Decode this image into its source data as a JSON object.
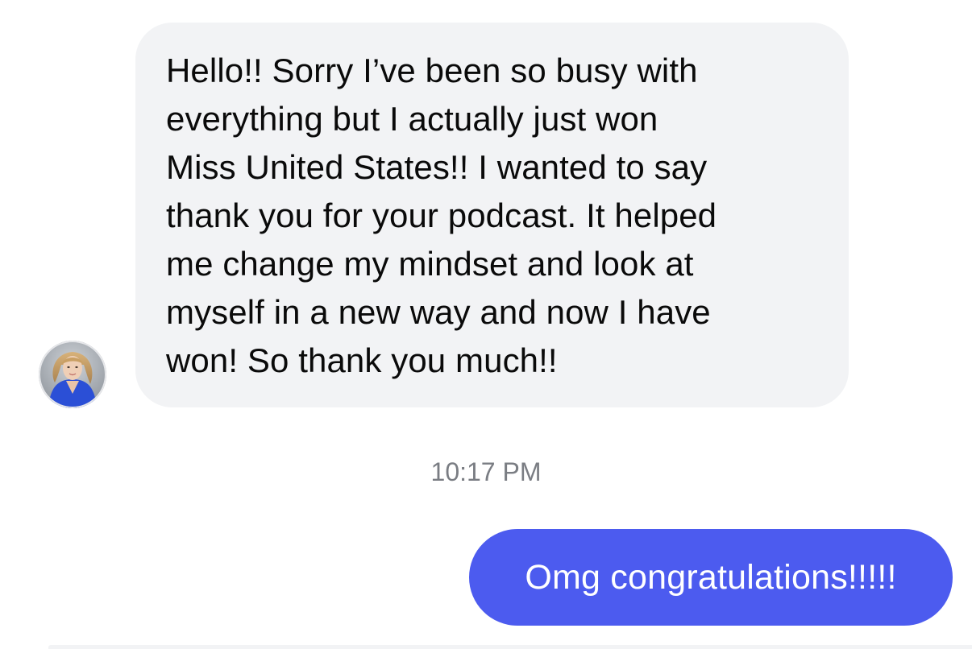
{
  "conversation": {
    "incoming_message": {
      "text": "Hello!! Sorry I’ve been so busy with\neverything but I actually just won\nMiss United States!! I wanted to say\nthank you for your podcast. It helped\nme change my mindset and look at\nmyself in a new way and now I have\nwon! So thank you much!!",
      "bubble_color": "#f2f3f5",
      "text_color": "#0a0a0a"
    },
    "timestamp": "10:17 PM",
    "outgoing_message": {
      "text": "Omg congratulations!!!!!",
      "bubble_color": "#4c5bef",
      "text_color": "#ffffff"
    },
    "sender_avatar": {
      "icon": "profile-photo",
      "ring_color": "#e6e7ea"
    }
  }
}
